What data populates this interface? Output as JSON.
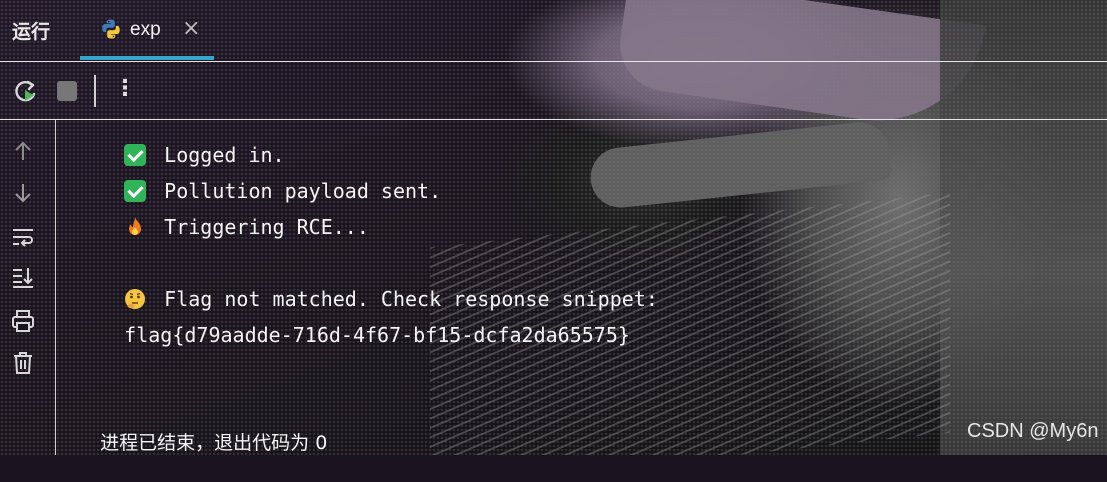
{
  "tabbar": {
    "run_label": "运行",
    "tab": {
      "name": "exp",
      "icon": "python-icon",
      "close_glyph": "×"
    }
  },
  "toolbar": {
    "rerun_icon": "rerun-icon",
    "stop_icon": "stop-icon",
    "more_glyph": "⋮"
  },
  "gutter": {
    "icons": [
      "scroll-up-icon",
      "scroll-down-icon",
      "soft-wrap-icon",
      "scroll-to-end-icon",
      "print-icon",
      "trash-icon"
    ]
  },
  "console": {
    "lines": [
      {
        "icon": "check-icon",
        "text": "Logged in."
      },
      {
        "icon": "check-icon",
        "text": "Pollution payload sent."
      },
      {
        "icon": "fire-icon",
        "text": "Triggering RCE..."
      },
      {
        "icon": "thinking-face-icon",
        "text": "Flag not matched. Check response snippet:"
      },
      {
        "icon": "",
        "text": "flag{d79aadde-716d-4f67-bf15-dcfa2da65575}"
      },
      {
        "icon": "",
        "text": "进程已结束，退出代码为 0"
      }
    ]
  },
  "watermark": "CSDN @My6n",
  "colors": {
    "accent": "#35a6c8",
    "success": "#2fb45a",
    "text": "#f4f4f4"
  }
}
